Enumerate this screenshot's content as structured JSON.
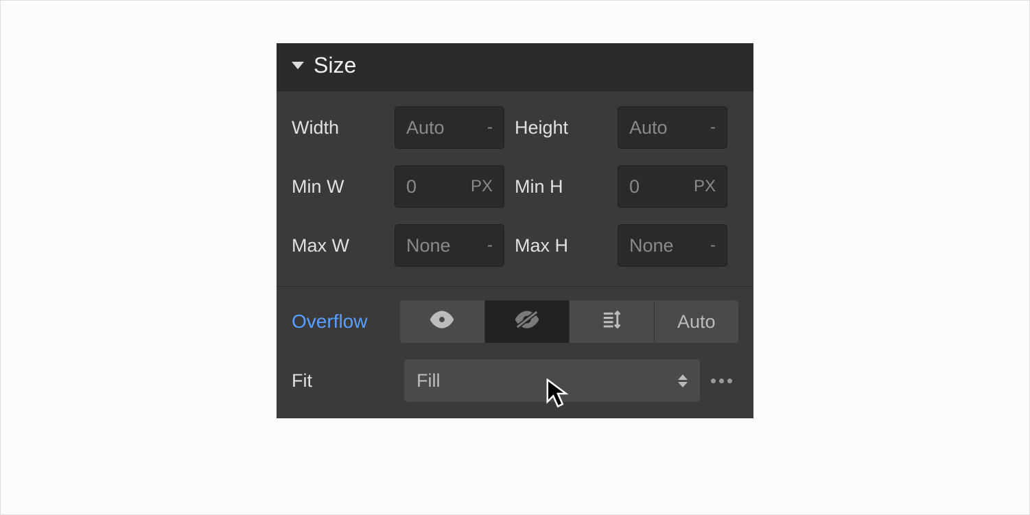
{
  "section": {
    "title": "Size"
  },
  "fields": {
    "width": {
      "label": "Width",
      "value": "Auto",
      "unit": "-"
    },
    "height": {
      "label": "Height",
      "value": "Auto",
      "unit": "-"
    },
    "minw": {
      "label": "Min W",
      "value": "0",
      "unit": "PX"
    },
    "minh": {
      "label": "Min H",
      "value": "0",
      "unit": "PX"
    },
    "maxw": {
      "label": "Max W",
      "value": "None",
      "unit": "-"
    },
    "maxh": {
      "label": "Max H",
      "value": "None",
      "unit": "-"
    }
  },
  "overflow": {
    "label": "Overflow",
    "options": {
      "visible": "eye-icon",
      "hidden": "eye-off-icon",
      "scroll": "scroll-icon",
      "auto": "Auto"
    },
    "active": "hidden"
  },
  "fit": {
    "label": "Fit",
    "value": "Fill"
  },
  "colors": {
    "accent_text": "#5a9eff",
    "panel_bg": "#3a3a3a",
    "header_bg": "#2b2b2b",
    "input_bg": "#2a2a2a"
  }
}
